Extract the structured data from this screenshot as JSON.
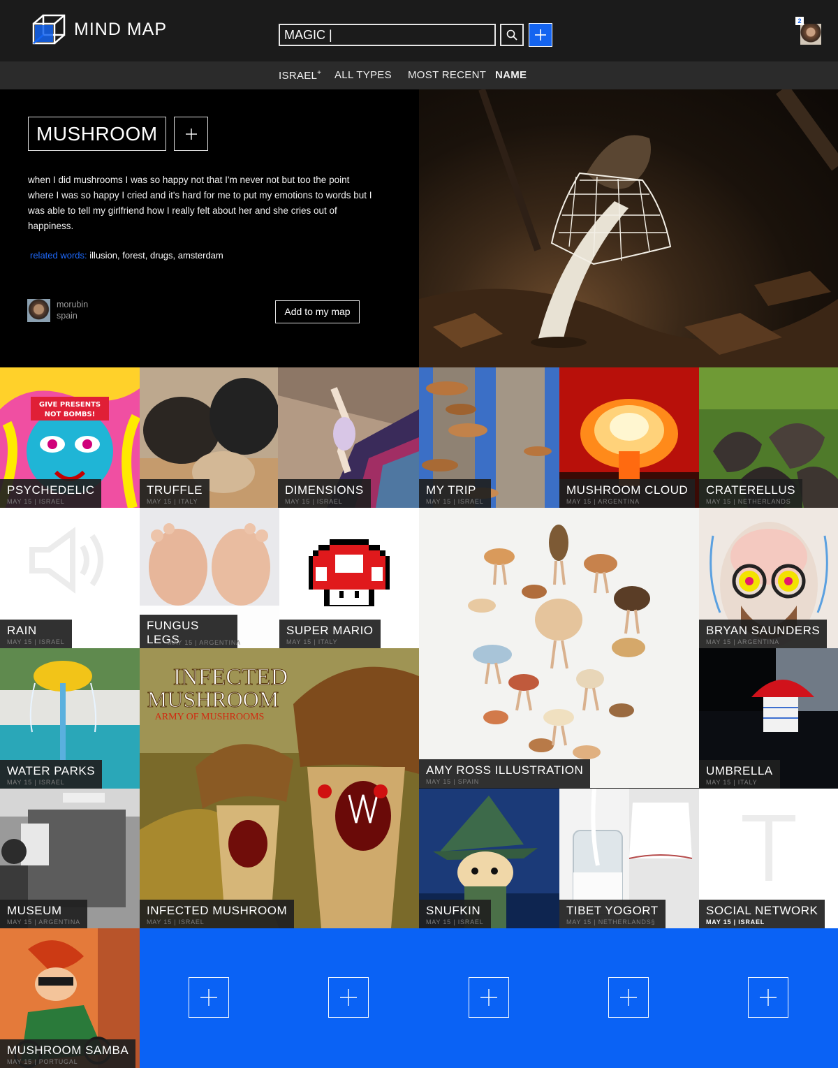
{
  "app": {
    "title": "MIND MAP"
  },
  "search": {
    "value": "MAGIC |"
  },
  "user": {
    "notifications": "2"
  },
  "filters": [
    {
      "label": "ISRAEL",
      "suffix": "+"
    },
    {
      "label": "ALL TYPES"
    },
    {
      "label": "MOST RECENT"
    },
    {
      "label": "NAME"
    }
  ],
  "hero": {
    "title": "MUSHROOM",
    "description": "when I did mushrooms I was so happy not that I'm never not but too the point where I was so happy I cried and it's hard for me to put my emotions to words but I was able to tell my girlfriend how I really felt about her and she cries out of happiness.",
    "related_label": "related words:",
    "related_words": "illusion, forest, drugs, amsterdam",
    "author": {
      "name": "morubin",
      "location": "spain"
    },
    "add_button": "Add to my map"
  },
  "tiles": [
    {
      "title": "PSYCHEDELIC",
      "meta": "MAY 15 | ISRAEL"
    },
    {
      "title": "TRUFFLE",
      "meta": "MAY 15 | ITALY"
    },
    {
      "title": "DIMENSIONS",
      "meta": "MAY 15 | ISRAEL"
    },
    {
      "title": "MY TRIP",
      "meta": "MAY 15 | ISRAEL"
    },
    {
      "title": "MUSHROOM CLOUD",
      "meta": "MAY 15 | ARGENTINA"
    },
    {
      "title": "CRATERELLUS",
      "meta": "MAY 15 | NETHERLANDS"
    },
    {
      "title": "RAIN",
      "meta": "MAY 15 | ISRAEL"
    },
    {
      "title": "FUNGUS LEGS",
      "meta": "MAY 15 | ARGENTINA"
    },
    {
      "title": "SUPER MARIO",
      "meta": "MAY 15 | ITALY"
    },
    {
      "title": "AMY ROSS ILLUSTRATION",
      "meta": "MAY 15 | SPAIN"
    },
    {
      "title": "BRYAN SAUNDERS",
      "meta": "MAY 15 | ARGENTINA"
    },
    {
      "title": "WATER PARKS",
      "meta": "MAY 15 | ISRAEL"
    },
    {
      "title": "INFECTED MUSHROOM",
      "meta": "MAY 15 | ISRAEL"
    },
    {
      "title": "UMBRELLA",
      "meta": "MAY 15 | ITALY"
    },
    {
      "title": "MUSEUM",
      "meta": "MAY 15 | ARGENTINA"
    },
    {
      "title": "SNUFKIN",
      "meta": "MAY 15 | ISRAEL"
    },
    {
      "title": "TIBET YOGORT",
      "meta": "MAY 15 | NETHERLANDS§"
    },
    {
      "title": "SOCIAL NETWORK",
      "meta": "MAY 15 | ISRAEL"
    },
    {
      "title": "MUSHROOM SAMBA",
      "meta": "MAY 15 | PORTUGAL"
    }
  ],
  "album_art": {
    "line1": "INFECTED",
    "line2": "MUSHROOM",
    "line3": "ARMY OF MUSHROOMS"
  },
  "psychedelic_art": {
    "line1": "GIVE PRESENTS",
    "line2": "NOT BOMBS!"
  },
  "colors": {
    "accent": "#1464f0",
    "add_tile": "#0a62f5",
    "related_label": "#1f6bff"
  }
}
